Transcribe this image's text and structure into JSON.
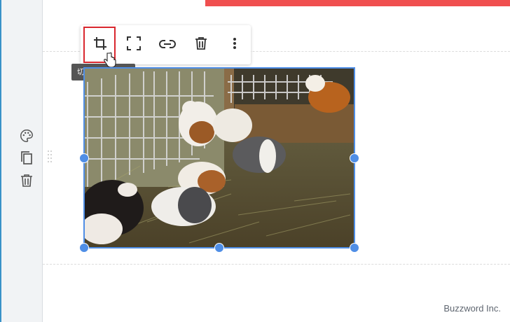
{
  "toolbar": {
    "crop_icon": "crop-icon",
    "fullscreen_icon": "fullscreen-icon",
    "link_icon": "link-icon",
    "delete_icon": "trash-icon",
    "more_icon": "more-vertical-icon",
    "tooltip": "切り抜き (確定)"
  },
  "rail": {
    "icons": [
      "palette-icon",
      "copy-icon",
      "trash-icon"
    ]
  },
  "image": {
    "subject": "guinea pigs in hay pen",
    "selected": true
  },
  "footer": {
    "brand": "Buzzword Inc."
  },
  "colors": {
    "accent": "#4f8ee6",
    "highlight": "#d9272e",
    "top_bar": "#f04f4f",
    "rail_bg": "#f1f3f5"
  }
}
